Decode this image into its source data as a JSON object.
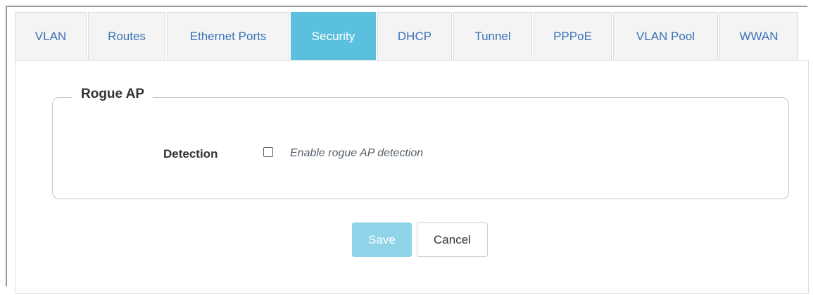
{
  "tabs": [
    {
      "label": "VLAN",
      "active": false
    },
    {
      "label": "Routes",
      "active": false
    },
    {
      "label": "Ethernet Ports",
      "active": false
    },
    {
      "label": "Security",
      "active": true
    },
    {
      "label": "DHCP",
      "active": false
    },
    {
      "label": "Tunnel",
      "active": false
    },
    {
      "label": "PPPoE",
      "active": false
    },
    {
      "label": "VLAN Pool",
      "active": false
    },
    {
      "label": "WWAN",
      "active": false
    }
  ],
  "section": {
    "legend": "Rogue AP",
    "detection": {
      "label": "Detection",
      "checked": false,
      "description": "Enable rogue AP detection"
    }
  },
  "buttons": {
    "save_label": "Save",
    "cancel_label": "Cancel"
  },
  "colors": {
    "accent": "#5bc0de",
    "save_disabled": "#8fd3e8",
    "link": "#3a72b8"
  }
}
